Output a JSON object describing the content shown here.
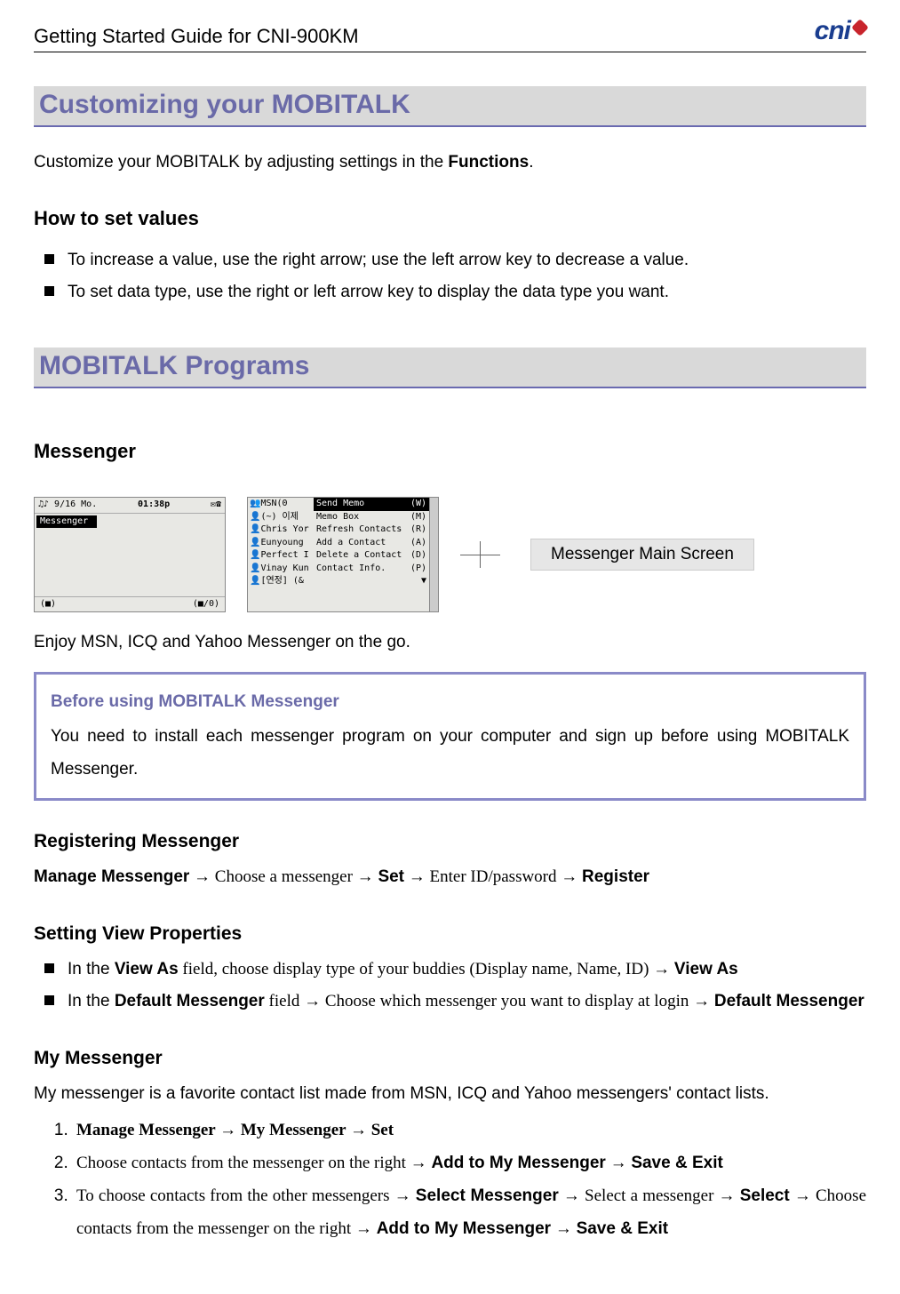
{
  "header": {
    "title": "Getting Started Guide for CNI-900KM",
    "logo_text": "cni"
  },
  "section1": {
    "heading": "Customizing your MOBITALK",
    "intro_a": "Customize your MOBITALK by adjusting settings in the ",
    "intro_b": "Functions",
    "intro_c": ".",
    "how_heading": "How to set values",
    "how1": "To increase a value, use the right arrow; use the left arrow key to decrease a value.",
    "how2": "To set data type, use the right or left arrow key to display the data type you want."
  },
  "section2": {
    "heading": "MOBITALK Programs",
    "messenger_heading": "Messenger",
    "screen1": {
      "status_left": "♫♪ 9/16 Mo.",
      "status_mid": "01:38p",
      "status_right": "✉☎",
      "label": "Messenger",
      "footer_left": "(■)",
      "footer_right": "(■/0)"
    },
    "screen2": {
      "rows": [
        {
          "left": "👥MSN(0",
          "mid": "Send Memo",
          "right": "(W)"
        },
        {
          "left": "👤(~) 이제",
          "mid": "Memo Box",
          "right": "(M)"
        },
        {
          "left": "👤Chris Yor",
          "mid": "Refresh Contacts",
          "right": "(R)"
        },
        {
          "left": "👤Eunyoung",
          "mid": "Add a Contact",
          "right": "(A)"
        },
        {
          "left": "👤Perfect I",
          "mid": "Delete a Contact",
          "right": "(D)"
        },
        {
          "left": "👤Vinay Kun",
          "mid": "Contact Info.",
          "right": "(P)"
        },
        {
          "left": "👤[연정] (&",
          "mid": "",
          "right": "▼"
        }
      ]
    },
    "callout": "Messenger Main Screen",
    "enjoy": "Enjoy MSN, ICQ and Yahoo Messenger on the go.",
    "infobox": {
      "title": "Before using MOBITALK Messenger",
      "body": "You need to install each messenger program on your computer and sign up before using MOBITALK Messenger."
    },
    "reg": {
      "heading": "Registering Messenger",
      "b1": "Manage Messenger",
      "t1": " → Choose a messenger → ",
      "b2": "Set",
      "t2": " → Enter ID/password → ",
      "b3": "Register"
    },
    "view": {
      "heading": "Setting View Properties",
      "item1_a": "In the ",
      "item1_b": "View As",
      "item1_c": " field, choose display type of your buddies (Display name, Name, ID) → ",
      "item1_d": "View As",
      "item2_a": "In the ",
      "item2_b": "Default Messenger",
      "item2_c": " field → Choose which messenger you want to display at login → ",
      "item2_d": "Default Messenger"
    },
    "mymess": {
      "heading": "My Messenger",
      "intro": "My messenger is a favorite contact list made from MSN, ICQ and Yahoo messengers' contact lists.",
      "step1_b1": "Manage Messenger → My Messenger → Set",
      "step2_a": "Choose contacts from the messenger on the right → ",
      "step2_b1": "Add to My Messenger",
      "step2_m": " → ",
      "step2_b2": "Save & Exit",
      "step3_a": "To choose contacts from the other messengers → ",
      "step3_b1": "Select Messenger",
      "step3_b": " → Select a messenger → ",
      "step3_b2": "Select",
      "step3_c": " → Choose contacts from the messenger on the right → ",
      "step3_b3": "Add to My Messenger",
      "step3_d": " → ",
      "step3_b4": "Save & Exit"
    }
  }
}
